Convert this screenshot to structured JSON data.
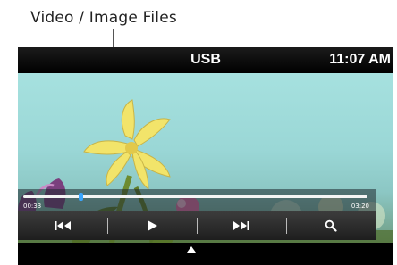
{
  "annotation": {
    "label": "Video / Image Files"
  },
  "status_bar": {
    "source": "USB",
    "clock": "11:07 AM"
  },
  "playback": {
    "elapsed": "00:33",
    "total": "03:20",
    "progress_fraction": 0.165
  },
  "controls": {
    "icons": [
      "previous-track-icon",
      "play-icon",
      "next-track-icon",
      "search-icon"
    ]
  },
  "colors": {
    "accent": "#3aa6ff",
    "sky": "#a6e1df",
    "flower": "#f2e46a"
  }
}
